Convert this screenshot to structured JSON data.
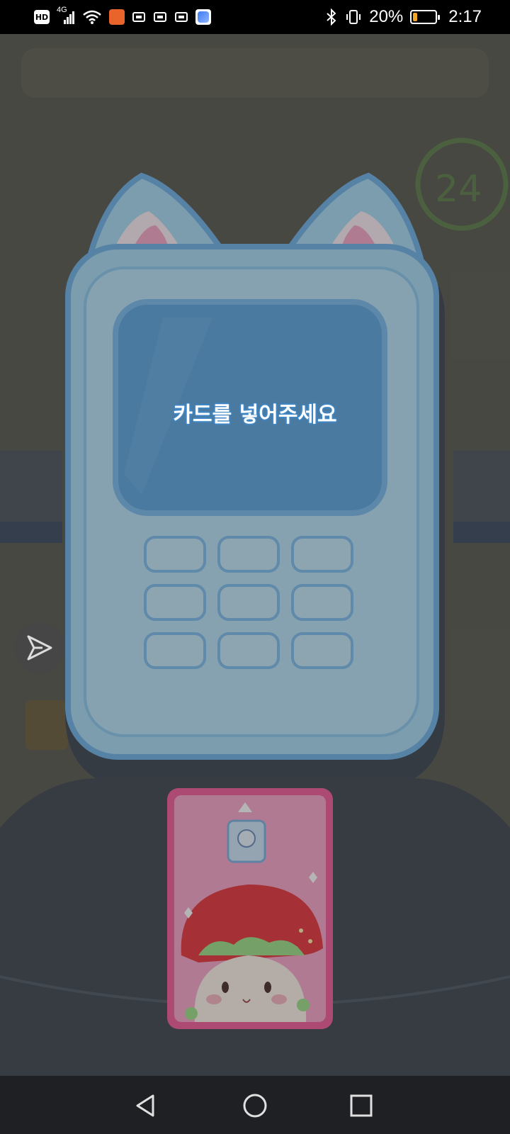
{
  "status_bar": {
    "hd_label": "HD",
    "network_label": "4G",
    "battery_text": "20%",
    "battery_level": 0.2,
    "time": "2:17",
    "icons": [
      "hd-icon",
      "signal-icon",
      "wifi-icon",
      "app-notification-icon",
      "app-notification-icon",
      "app-notification-icon",
      "app-notification-icon",
      "browser-icon",
      "bluetooth-icon",
      "vibrate-icon",
      "battery-icon"
    ]
  },
  "game": {
    "terminal_prompt": "카드를 넣어주세요",
    "clock_sign": "24",
    "colors": {
      "terminal_body": "#a9dcf6",
      "terminal_screen": "#5ea6e2",
      "card_pink": "#f78fbd",
      "accent_border": "#6fb3ea"
    }
  },
  "controls": {
    "share_icon": "send-icon"
  },
  "nav_bar": {
    "back": "back-icon",
    "home": "home-icon",
    "recents": "recents-icon"
  }
}
